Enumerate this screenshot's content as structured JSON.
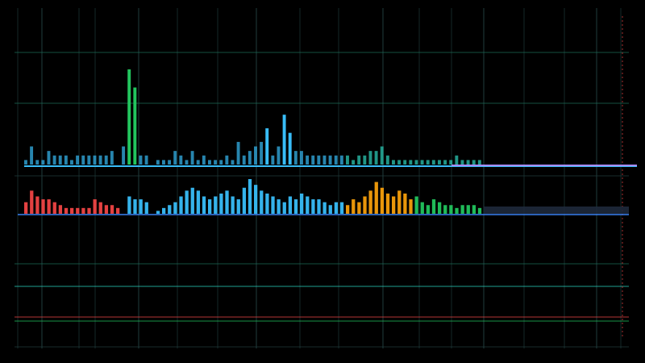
{
  "chart_data": {
    "type": "bar",
    "title": "",
    "xlabel": "",
    "ylabel": "",
    "grid": true,
    "legend": "none",
    "colors": {
      "background": "#000000",
      "grid_vertical": "#1f3a3a",
      "grid_horizontal": "#1a6b55",
      "cyan": "#38bdf8",
      "teal": "#2dd4bf",
      "green": "#22c55e",
      "orange": "#f59e0b",
      "red": "#ef4444",
      "pink": "#f472b6",
      "violet": "#a78bfa",
      "navy": "#1e293b",
      "blue": "#3b82f6"
    },
    "upper_series": {
      "name": "",
      "values": [
        1,
        4,
        1,
        1,
        3,
        2,
        2,
        2,
        1,
        2,
        2,
        2,
        2,
        2,
        2,
        3,
        0,
        4,
        21,
        17,
        2,
        2,
        0,
        1,
        1,
        1,
        3,
        2,
        1,
        3,
        1,
        2,
        1,
        1,
        1,
        2,
        1,
        5,
        2,
        3,
        4,
        5,
        8,
        2,
        4,
        11,
        7,
        3,
        3,
        2,
        2,
        2,
        2,
        2,
        2,
        2,
        2,
        1,
        2,
        2,
        3,
        3,
        4,
        2,
        1,
        1,
        1,
        1,
        1,
        1,
        1,
        1,
        1,
        1,
        1,
        2,
        1,
        1,
        1,
        1
      ]
    },
    "lower_series": {
      "name": "",
      "values": [
        4,
        8,
        6,
        5,
        5,
        4,
        3,
        2,
        2,
        2,
        2,
        2,
        5,
        4,
        3,
        3,
        2,
        0,
        6,
        5,
        5,
        4,
        0,
        1,
        2,
        3,
        4,
        6,
        8,
        9,
        8,
        6,
        5,
        6,
        7,
        8,
        6,
        5,
        9,
        12,
        10,
        8,
        7,
        6,
        5,
        4,
        6,
        5,
        7,
        6,
        5,
        5,
        4,
        3,
        4,
        4,
        3,
        5,
        4,
        6,
        8,
        11,
        9,
        7,
        6,
        8,
        7,
        5,
        6,
        4,
        3,
        5,
        4,
        3,
        3,
        2,
        3,
        3,
        3,
        2
      ]
    }
  }
}
